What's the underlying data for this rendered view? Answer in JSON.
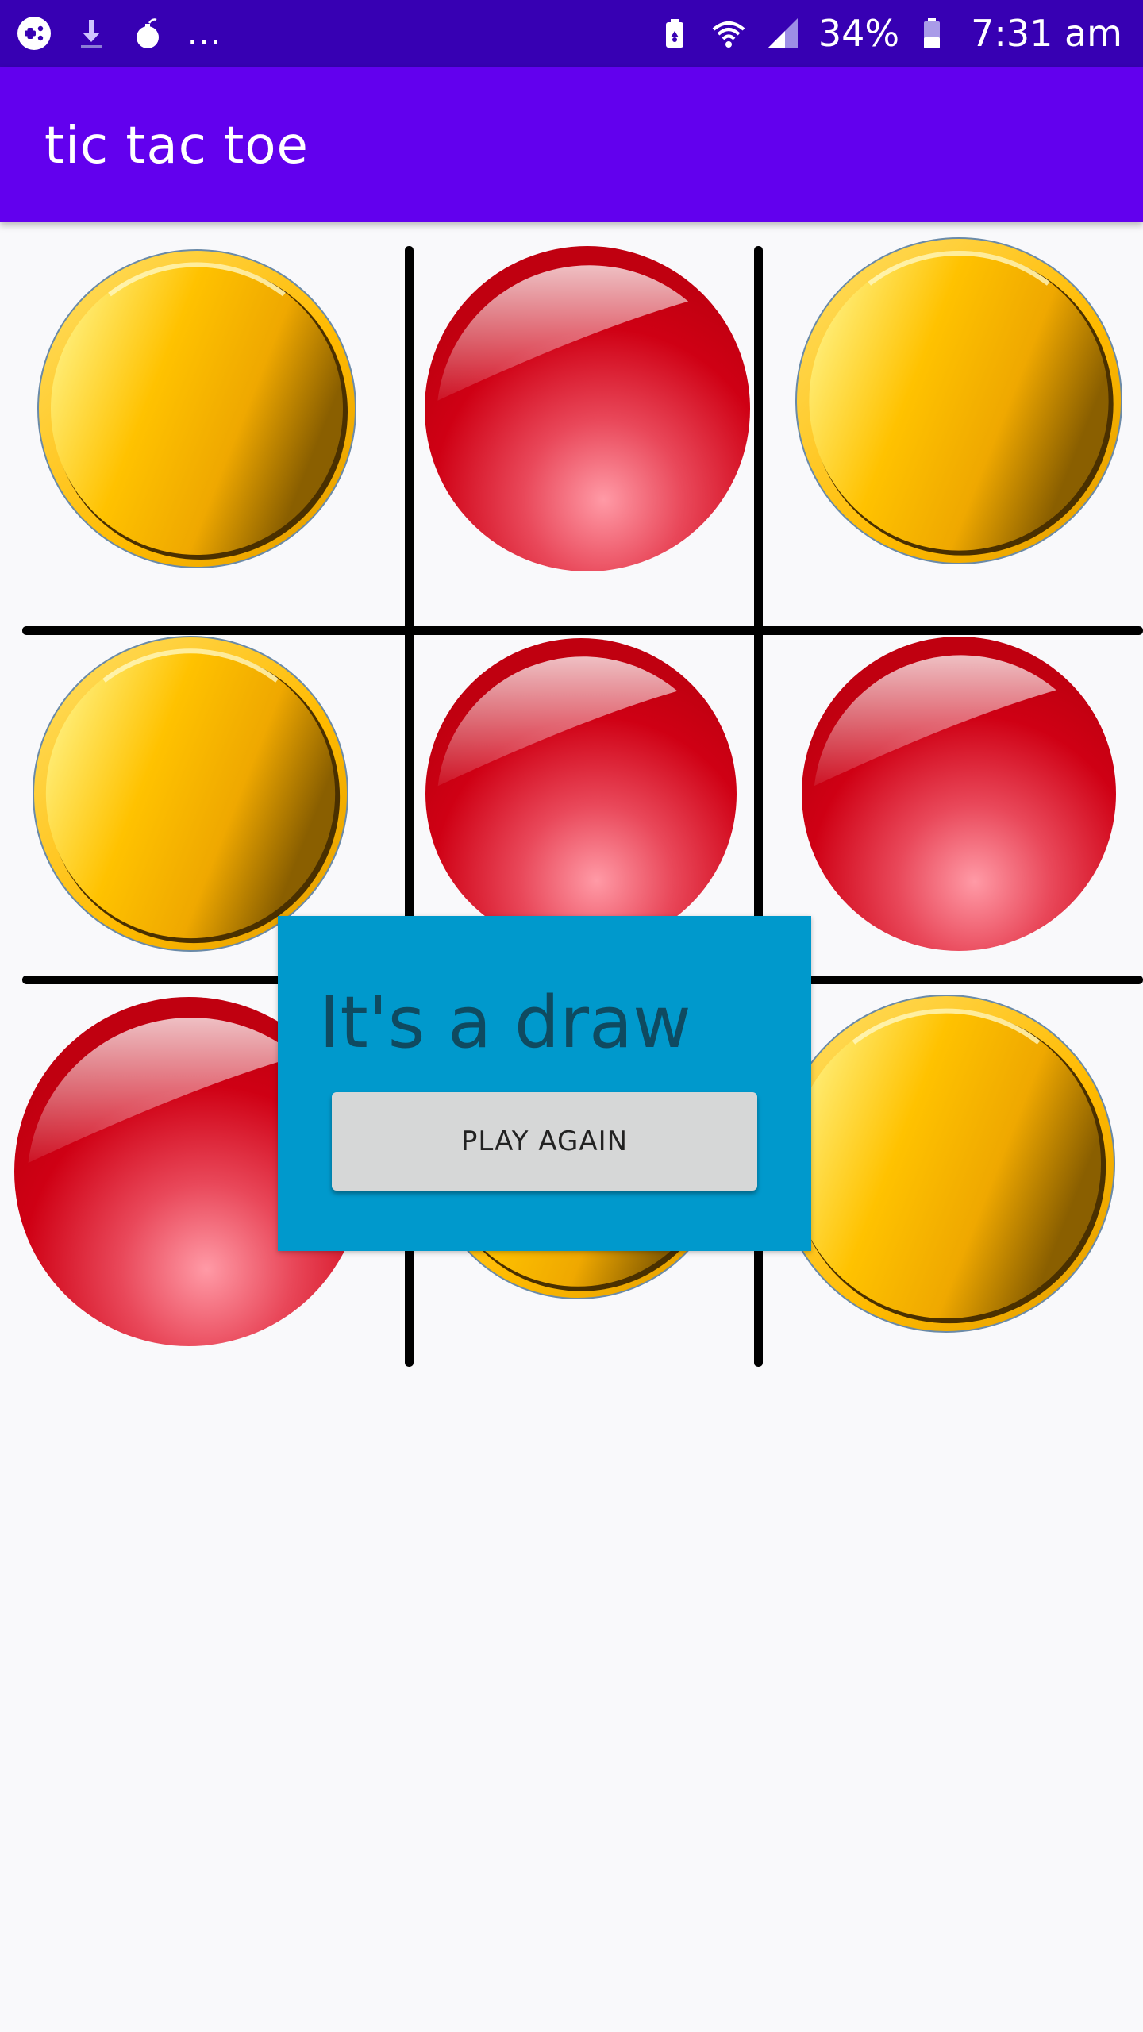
{
  "status_bar": {
    "left_icons": [
      "game-controller-icon",
      "download-icon",
      "bomb-icon"
    ],
    "more_indicator": "...",
    "right_icons": [
      "battery-saver-icon",
      "wifi-icon",
      "cell-signal-icon",
      "battery-icon"
    ],
    "battery_percent": "34%",
    "time": "7:31 am"
  },
  "app_bar": {
    "title": "tic tac toe"
  },
  "board": {
    "grid": [
      [
        "yellow",
        "red",
        "yellow"
      ],
      [
        "yellow",
        "red",
        "red"
      ],
      [
        "red",
        "yellow",
        "yellow"
      ]
    ],
    "colors": {
      "yellow": "#ffc107",
      "red": "#d0021b",
      "grid_line": "#000000"
    }
  },
  "dialog": {
    "message": "It's a draw",
    "button_label": "Play again",
    "background": "#0099cc"
  },
  "colors": {
    "status_bar": "#3700b3",
    "app_bar": "#6200ee",
    "background": "#f9f9fb"
  }
}
